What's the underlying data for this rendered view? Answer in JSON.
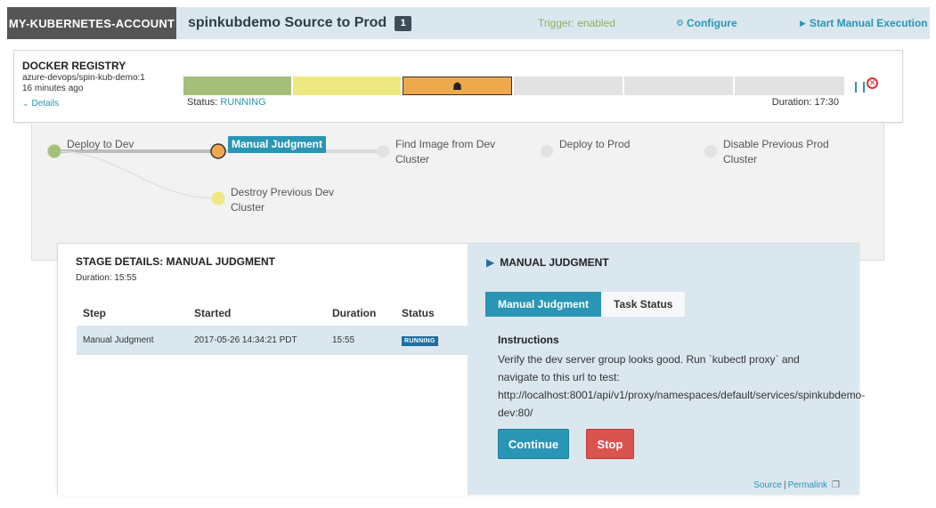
{
  "header": {
    "account": "MY-KUBERNETES-ACCOUNT",
    "pipeline_title": "spinkubdemo Source to Prod",
    "execution_count": "1",
    "trigger_status": "Trigger: enabled",
    "configure_label": "Configure",
    "start_manual_label": "Start Manual Execution"
  },
  "execution": {
    "trigger_type": "DOCKER REGISTRY",
    "image": "azure-devops/spin-kub-demo:1",
    "time_ago": "16 minutes ago",
    "details_label": "Details",
    "status_label": "Status:",
    "status_value": "RUNNING",
    "duration_text": "Duration: 17:30",
    "stage_segments": [
      {
        "status": "succeeded",
        "weight": 1
      },
      {
        "status": "terminal",
        "weight": 1
      },
      {
        "status": "running",
        "weight": 1
      },
      {
        "status": "not_started",
        "weight": 1
      },
      {
        "status": "not_started",
        "weight": 1
      },
      {
        "status": "not_started",
        "weight": 1
      }
    ]
  },
  "graph": {
    "nodes": {
      "deploy_dev": "Deploy to Dev",
      "manual_judgment": "Manual Judgment",
      "find_image_l1": "Find Image from Dev",
      "find_image_l2": "Cluster",
      "deploy_prod": "Deploy to Prod",
      "disable_prev_l1": "Disable Previous Prod",
      "disable_prev_l2": "Cluster",
      "destroy_prev_l1": "Destroy Previous Dev",
      "destroy_prev_l2": "Cluster"
    },
    "colors": {
      "succeeded": "#a5bf7a",
      "running": "#eea94c",
      "terminal": "#efe882",
      "not_started": "#e2e2e2"
    }
  },
  "stage_details": {
    "title": "STAGE DETAILS: MANUAL JUDGMENT",
    "duration": "Duration: 15:55",
    "columns": [
      "Step",
      "Started",
      "Duration",
      "Status"
    ],
    "rows": [
      {
        "step": "Manual Judgment",
        "started": "2017-05-26 14:34:21 PDT",
        "duration": "15:55",
        "status": "RUNNING"
      }
    ]
  },
  "manual_judgment": {
    "title": "MANUAL JUDGMENT",
    "tabs": [
      "Manual Judgment",
      "Task Status"
    ],
    "instructions_heading": "Instructions",
    "instructions_line1": "Verify the dev server group looks good. Run `kubectl proxy` and",
    "instructions_line2": "navigate to this url to test:",
    "instructions_line3": "http://localhost:8001/api/v1/proxy/namespaces/default/services/spinkubdemo-",
    "instructions_line4": "dev:80/",
    "continue_label": "Continue",
    "stop_label": "Stop",
    "source_label": "Source",
    "permalink_label": "Permalink"
  }
}
